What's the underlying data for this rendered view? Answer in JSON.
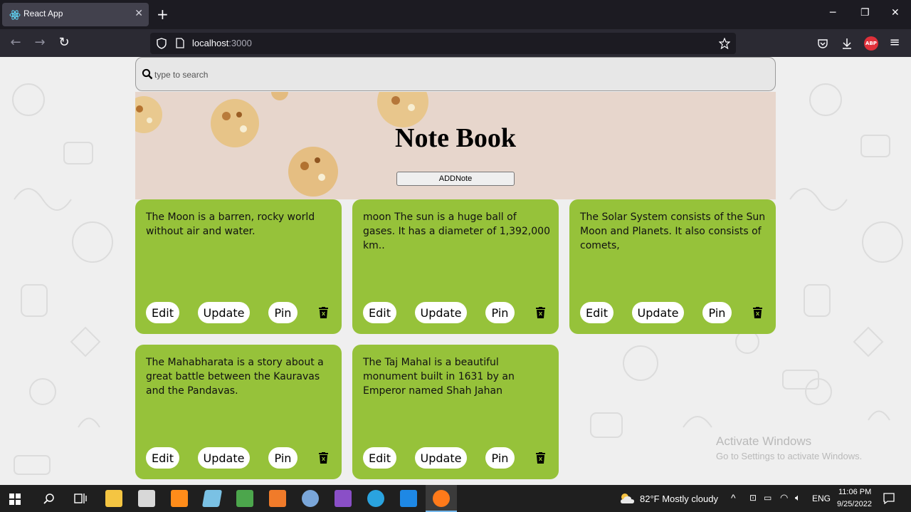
{
  "browser": {
    "tab_title": "React App",
    "url_host": "localhost",
    "url_port": ":3000",
    "abp_label": "ABP"
  },
  "search": {
    "placeholder": "type to search"
  },
  "banner": {
    "title": "Note Book",
    "add_button": "ADDNote"
  },
  "notes": [
    {
      "text": "The Moon is a barren, rocky world without air and water."
    },
    {
      "text": "moon The sun is a huge ball of gases. It has a diameter of 1,392,000 km.."
    },
    {
      "text": "The Solar System consists of the Sun Moon and Planets. It also consists of comets,"
    },
    {
      "text": "The Mahabharata is a story about a great battle between the Kauravas and the Pandavas."
    },
    {
      "text": "The Taj Mahal is a beautiful monument built in 1631 by an Emperor named Shah Jahan"
    }
  ],
  "card_actions": {
    "edit": "Edit",
    "update": "Update",
    "pin": "Pin"
  },
  "watermark": {
    "line1": "Activate Windows",
    "line2": "Go to Settings to activate Windows."
  },
  "taskbar": {
    "weather": "82°F  Mostly cloudy",
    "language": "ENG",
    "time": "11:06 PM",
    "date": "9/25/2022"
  },
  "colors": {
    "card": "#96c23a",
    "banner": "#e7d6cc"
  }
}
